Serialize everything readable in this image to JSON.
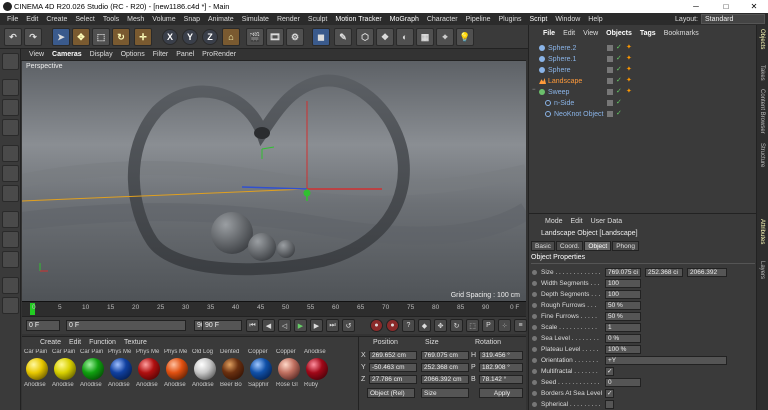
{
  "window": {
    "title": "CINEMA 4D R20.026 Studio (RC - R20) - [new1186.c4d *] - Main",
    "minimize": "─",
    "maximize": "□",
    "close": "✕"
  },
  "menubar": {
    "items": [
      "File",
      "Edit",
      "Create",
      "Select",
      "Tools",
      "Mesh",
      "Volume",
      "Snap",
      "Animate",
      "Simulate",
      "Render",
      "Sculpt",
      "Motion Tracker",
      "MoGraph",
      "Character",
      "Pipeline",
      "Plugins",
      "Script",
      "Window",
      "Help"
    ],
    "layout_label": "Layout:",
    "layout_value": "Standard"
  },
  "toolbar": {
    "x": "X",
    "y": "Y",
    "z": "Z"
  },
  "viewport": {
    "menu": [
      "View",
      "Cameras",
      "Display",
      "Options",
      "Filter",
      "Panel",
      "ProRender"
    ],
    "label": "Perspective",
    "grid_spacing": "Grid Spacing : 100 cm"
  },
  "timeline": {
    "ticks": [
      "0",
      "5",
      "10",
      "15",
      "20",
      "25",
      "30",
      "35",
      "40",
      "45",
      "50",
      "55",
      "60",
      "65",
      "70",
      "75",
      "80",
      "85",
      "90"
    ],
    "end_label": "0 F",
    "start_frame": "0 F",
    "min_frame": "0 F",
    "max_frame": "90 F",
    "end_frame": "90 F"
  },
  "materials": {
    "menu": [
      "Create",
      "Edit",
      "Function",
      "Texture"
    ],
    "items": [
      {
        "top": "Car Pain",
        "bottom": "Anodise",
        "color": "#e8c800"
      },
      {
        "top": "Car Pain",
        "bottom": "Anodise",
        "color": "#d8d000"
      },
      {
        "top": "Car Pain",
        "bottom": "Anodise",
        "color": "#10a010"
      },
      {
        "top": "Phys Me",
        "bottom": "Anodise",
        "color": "#1040a0"
      },
      {
        "top": "Phys Me",
        "bottom": "Anodise",
        "color": "#b01010"
      },
      {
        "top": "Phys Me",
        "bottom": "Anodise",
        "color": "#e05010"
      },
      {
        "top": "Old Log",
        "bottom": "Anodise",
        "color": "#c8c8c8"
      },
      {
        "top": "Dented",
        "bottom": "Beer Bo",
        "color": "#6a3010"
      },
      {
        "top": "Copper",
        "bottom": "Sapphir",
        "color": "#1050a8"
      },
      {
        "top": "Copper",
        "bottom": "Rose Gl",
        "color": "#c07060"
      },
      {
        "top": "Anodise",
        "bottom": "Ruby",
        "color": "#a00818"
      }
    ]
  },
  "coordinates": {
    "headers": [
      "Position",
      "Size",
      "Rotation"
    ],
    "rows": [
      {
        "axis": "X",
        "pos": "269.652 cm",
        "size": "769.075 cm",
        "rlabel": "H",
        "rot": "319.456 °"
      },
      {
        "axis": "Y",
        "pos": "-50.463 cm",
        "size": "252.368 cm",
        "rlabel": "P",
        "rot": "182.908 °"
      },
      {
        "axis": "Z",
        "pos": "27.786 cm",
        "size": "2066.392 cm",
        "rlabel": "B",
        "rot": "78.142 °"
      }
    ],
    "mode": "Object (Rel)",
    "size_mode": "Size",
    "apply": "Apply"
  },
  "objects": {
    "menu": [
      "File",
      "Edit",
      "View",
      "Objects",
      "Tags",
      "Bookmarks"
    ],
    "items": [
      {
        "name": "Sphere.2",
        "indent": 0,
        "color": "#8ab4e8"
      },
      {
        "name": "Sphere.1",
        "indent": 0,
        "color": "#8ab4e8"
      },
      {
        "name": "Sphere",
        "indent": 0,
        "color": "#8ab4e8"
      },
      {
        "name": "Landscape",
        "indent": 0,
        "color": "#ff9a3a"
      },
      {
        "name": "Sweep",
        "indent": 0,
        "color": "#8ab4e8"
      },
      {
        "name": "n-Side",
        "indent": 1,
        "color": "#8ab4e8"
      },
      {
        "name": "NeoKnot Object",
        "indent": 1,
        "color": "#8ab4e8"
      }
    ]
  },
  "attributes": {
    "menu": [
      "Mode",
      "Edit",
      "User Data"
    ],
    "title": "Landscape Object [Landscape]",
    "tabs": [
      "Basic",
      "Coord.",
      "Object",
      "Phong"
    ],
    "section": "Object Properties",
    "props": [
      {
        "label": "Size . . . . . . . . . . . . .",
        "v1": "769.075 ci",
        "v2": "252.368 ci",
        "v3": "2066.392"
      },
      {
        "label": "Width Segments . . .",
        "v1": "100"
      },
      {
        "label": "Depth Segments . . .",
        "v1": "100"
      },
      {
        "label": "Rough Furrows . . .",
        "v1": "50 %"
      },
      {
        "label": "Fine Furrows . . . . .",
        "v1": "50 %"
      },
      {
        "label": "Scale . . . . . . . . . . .",
        "v1": "1"
      },
      {
        "label": "Sea Level . . . . . . . .",
        "v1": "0 %"
      },
      {
        "label": "Plateau Level . . . . .",
        "v1": "100 %"
      },
      {
        "label": "Orientation . . . . . . .",
        "v1": "+Y"
      },
      {
        "label": "Multifractal . . . . . . .",
        "v1": "✓"
      },
      {
        "label": "Seed . . . . . . . . . . . .",
        "v1": "0"
      },
      {
        "label": "Borders At Sea Level",
        "v1": "✓"
      },
      {
        "label": "Spherical . . . . . . . . .",
        "v1": ""
      }
    ]
  },
  "sidetabs": [
    "Objects",
    "Takes",
    "Content Browser",
    "Structure",
    "Attributes",
    "Layers"
  ]
}
